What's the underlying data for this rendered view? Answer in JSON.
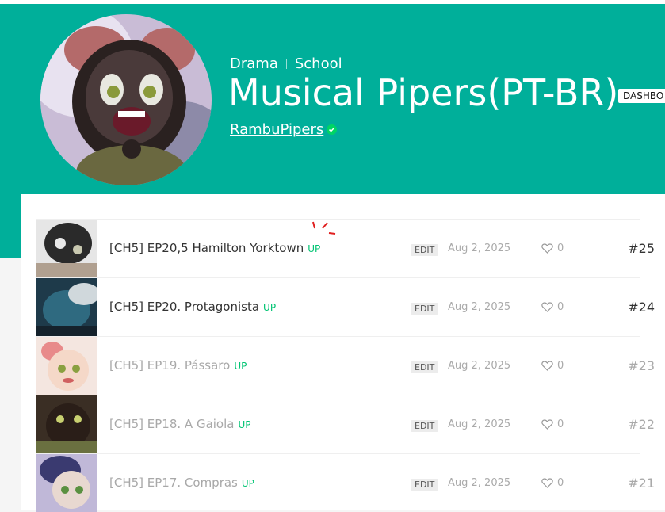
{
  "series": {
    "genres": [
      "Drama",
      "School"
    ],
    "title": "Musical Pipers(PT-BR)",
    "dashboard_label": "DASHBO",
    "author": "RambuPipers"
  },
  "episodes": [
    {
      "title": "[CH5] EP20,5 Hamilton Yorktown",
      "badge": "UP",
      "edit": "EDIT",
      "date": "Aug 2, 2025",
      "likes": "0",
      "number": "#25"
    },
    {
      "title": "[CH5] EP20. Protagonista",
      "badge": "UP",
      "edit": "EDIT",
      "date": "Aug 2, 2025",
      "likes": "0",
      "number": "#24"
    },
    {
      "title": "[CH5] EP19. Pássaro",
      "badge": "UP",
      "edit": "EDIT",
      "date": "Aug 2, 2025",
      "likes": "0",
      "number": "#23"
    },
    {
      "title": "[CH5] EP18. A Gaiola",
      "badge": "UP",
      "edit": "EDIT",
      "date": "Aug 2, 2025",
      "likes": "0",
      "number": "#22"
    },
    {
      "title": "[CH5] EP17. Compras",
      "badge": "UP",
      "edit": "EDIT",
      "date": "Aug 2, 2025",
      "likes": "0",
      "number": "#21"
    }
  ],
  "colors": {
    "header": "#00af9a",
    "up_badge": "#00c473",
    "verified": "#00d564"
  }
}
